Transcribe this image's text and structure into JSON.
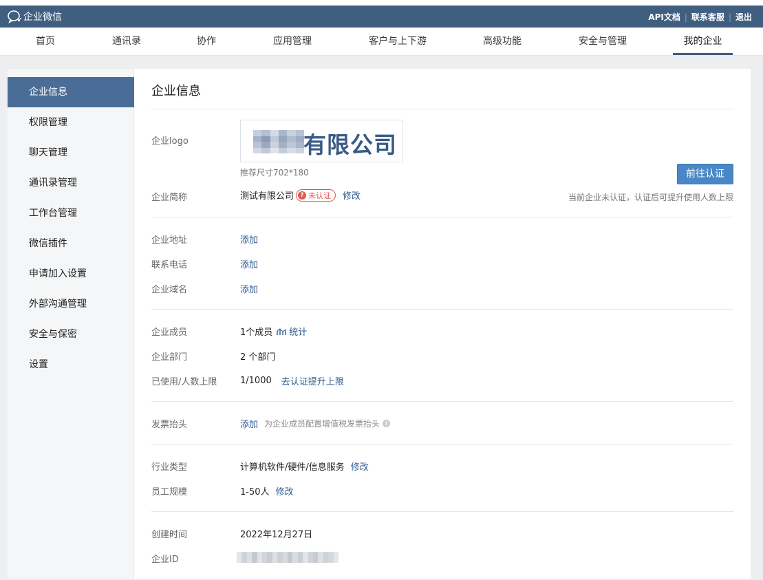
{
  "header": {
    "brand": "企业微信",
    "links": [
      "API文档",
      "联系客服",
      "退出"
    ],
    "separator": "|"
  },
  "nav": {
    "items": [
      "首页",
      "通讯录",
      "协作",
      "应用管理",
      "客户与上下游",
      "高级功能",
      "安全与管理",
      "我的企业"
    ],
    "active_index": 7
  },
  "sidebar": {
    "items": [
      "企业信息",
      "权限管理",
      "聊天管理",
      "通讯录管理",
      "工作台管理",
      "微信插件",
      "申请加入设置",
      "外部沟通管理",
      "安全与保密",
      "设置"
    ],
    "active_index": 0
  },
  "main": {
    "title": "企业信息",
    "logo": {
      "label": "企业logo",
      "text": "有限公司",
      "hint": "推荐尺寸702*180"
    },
    "short_name": {
      "label": "企业简称",
      "value": "测试有限公司",
      "badge": "未认证",
      "badge_icon": "?",
      "edit": "修改"
    },
    "certify": {
      "button": "前往认证",
      "hint": "当前企业未认证，认证后可提升使用人数上限"
    },
    "contact": {
      "address_label": "企业地址",
      "phone_label": "联系电话",
      "domain_label": "企业域名",
      "add": "添加"
    },
    "members": {
      "label": "企业成员",
      "value": "1个成员",
      "stats": "统计",
      "dept_label": "企业部门",
      "dept_value": "2 个部门",
      "limit_label": "已使用/人数上限",
      "limit_value": "1/1000",
      "limit_link": "去认证提升上限"
    },
    "invoice": {
      "label": "发票抬头",
      "add": "添加",
      "hint": "为企业成员配置增值税发票抬头",
      "info_icon": "i"
    },
    "industry": {
      "label": "行业类型",
      "value": "计算机软件/硬件/信息服务",
      "edit": "修改",
      "size_label": "员工规模",
      "size_value": "1-50人",
      "size_edit": "修改"
    },
    "meta": {
      "created_label": "创建时间",
      "created_value": "2022年12月27日",
      "id_label": "企业ID"
    }
  },
  "colors": {
    "topbar": "#3f5e80",
    "sidebar_active": "#4a6d97",
    "link": "#2b5a91",
    "primary_button": "#4a87c6",
    "badge": "#e05a4d"
  }
}
